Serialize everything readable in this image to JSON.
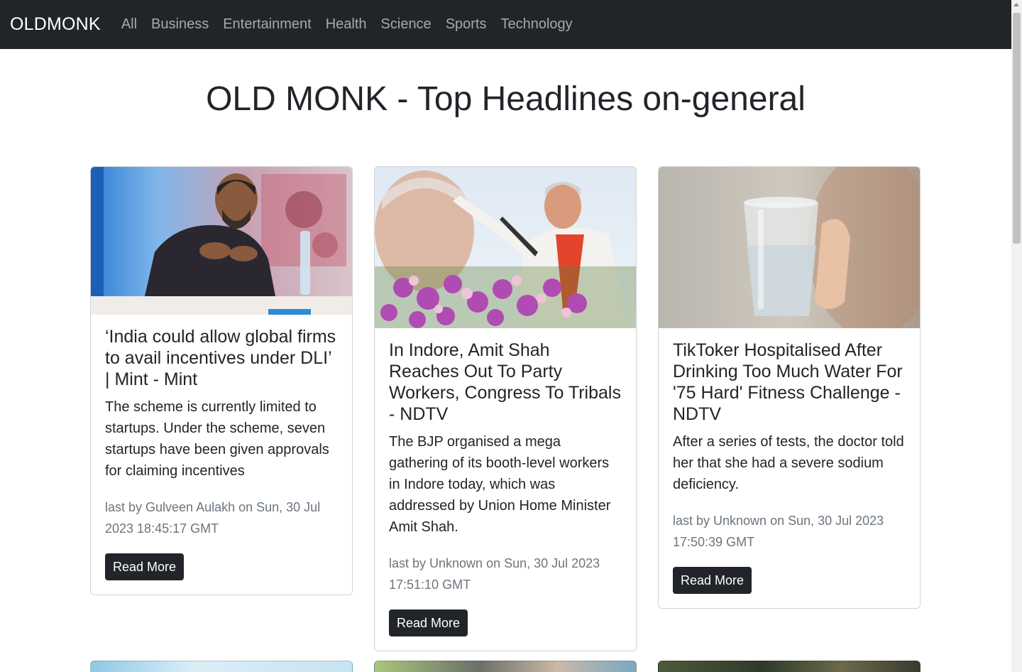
{
  "nav": {
    "brand": "OLDMONK",
    "links": [
      "All",
      "Business",
      "Entertainment",
      "Health",
      "Science",
      "Sports",
      "Technology"
    ]
  },
  "page": {
    "title": "OLD MONK - Top Headlines on-general"
  },
  "cards": [
    {
      "title": "‘India could allow global firms to avail incentives under DLI’ | Mint - Mint",
      "description": "The scheme is currently limited to startups. Under the scheme, seven startups have been given approvals for claiming incentives",
      "meta": "last by Gulveen Aulakh on Sun, 30 Jul 2023 18:45:17 GMT",
      "button": "Read More"
    },
    {
      "title": "In Indore, Amit Shah Reaches Out To Party Workers, Congress To Tribals - NDTV",
      "description": "The BJP organised a mega gathering of its booth-level workers in Indore today, which was addressed by Union Home Minister Amit Shah.",
      "meta": "last by Unknown on Sun, 30 Jul 2023 17:51:10 GMT",
      "button": "Read More"
    },
    {
      "title": "TikToker Hospitalised After Drinking Too Much Water For '75 Hard' Fitness Challenge - NDTV",
      "description": "After a series of tests, the doctor told her that she had a severe sodium deficiency.",
      "meta": "last by Unknown on Sun, 30 Jul 2023 17:50:39 GMT",
      "button": "Read More"
    }
  ],
  "colors": {
    "navbar": "#212529",
    "button": "#212529",
    "muted": "#6c757d"
  }
}
